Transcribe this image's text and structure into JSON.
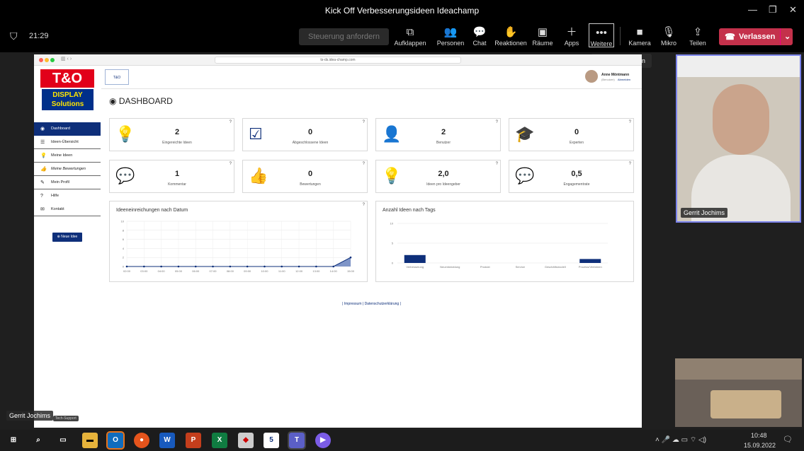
{
  "window": {
    "title": "Kick Off Verbesserungsideen Ideachamp"
  },
  "meeting": {
    "time": "21:29",
    "control_request": "Steuerung anfordern",
    "buttons": {
      "popout": "Aufklappen",
      "people": "Personen",
      "chat": "Chat",
      "reactions": "Reaktionen",
      "rooms": "Räume",
      "apps": "Apps",
      "more": "Weitere",
      "camera": "Kamera",
      "mic": "Mikro",
      "share": "Teilen",
      "leave": "Verlassen"
    },
    "tooltip": "Weitere Aktionen"
  },
  "browser": {
    "url": "ts-ds.idea-champ.com"
  },
  "app": {
    "logo_top": "T&O",
    "logo_bottom_1": "DISPLAY",
    "logo_bottom_2": "Solutions",
    "user": {
      "name": "Anne Möntmann",
      "role": "(Benutzer)",
      "logout": "Abmelden"
    },
    "nav": [
      {
        "label": "Dashboard",
        "icon": "dashboard-icon"
      },
      {
        "label": "Ideen-Übersicht",
        "icon": "list-icon"
      },
      {
        "label": "Meine Ideen",
        "icon": "bulb-icon"
      },
      {
        "label": "Meine Bewertungen",
        "icon": "thumb-icon"
      },
      {
        "label": "Mein Profil",
        "icon": "edit-icon"
      },
      {
        "label": "Hilfe",
        "icon": "help-icon"
      },
      {
        "label": "Kontakt",
        "icon": "mail-icon"
      }
    ],
    "new_idea_button": "⊕ Neue Idee",
    "page_title": "DASHBOARD",
    "cards": [
      {
        "value": "2",
        "label": "Eingereichte Ideen",
        "icon": "bulb-icon"
      },
      {
        "value": "0",
        "label": "Abgeschlossene Ideen",
        "icon": "check-icon"
      },
      {
        "value": "2",
        "label": "Benutzer",
        "icon": "user-icon"
      },
      {
        "value": "0",
        "label": "Experten",
        "icon": "graduation-cap-icon"
      },
      {
        "value": "1",
        "label": "Kommentar",
        "icon": "comments-icon"
      },
      {
        "value": "0",
        "label": "Bewertungen",
        "icon": "thumbs-up-icon"
      },
      {
        "value": "2,0",
        "label": "Ideen pro Ideengeber",
        "icon": "bulb-icon"
      },
      {
        "value": "0,5",
        "label": "Engagementrate",
        "icon": "comments-icon"
      }
    ],
    "footer": "| Impressum | Datenschutzerklärung |"
  },
  "chart_data": [
    {
      "type": "area",
      "title": "Ideeneinreichungen nach Datum",
      "x": [
        "02:00",
        "03:00",
        "04:00",
        "05:00",
        "06:00",
        "07:00",
        "08:00",
        "09:00",
        "10:00",
        "11:00",
        "12:00",
        "13:00",
        "14:00",
        "15:00"
      ],
      "values": [
        0,
        0,
        0,
        0,
        0,
        0,
        0,
        0,
        0,
        0,
        0,
        0,
        0,
        2
      ],
      "ylim": [
        0,
        10
      ],
      "yticks": [
        0,
        2,
        4,
        6,
        8,
        10
      ],
      "grid": true,
      "color": "#0e2f7a"
    },
    {
      "type": "bar",
      "title": "Anzahl Ideen nach Tags",
      "categories": [
        "Verbesserung",
        "Neuentwicklung",
        "Produkt",
        "Service",
        "Geschäftsmodell",
        "Prozess/Verfahren"
      ],
      "values": [
        2,
        0,
        0,
        0,
        0,
        1
      ],
      "ylim": [
        0,
        10
      ],
      "yticks": [
        0,
        5,
        10
      ],
      "grid": true,
      "color": "#0e2f7a"
    }
  ],
  "participants": {
    "self": "Gerrit Jochims",
    "presenter": "Gerrit Jochims",
    "badge": "Tech-Support"
  },
  "taskbar": {
    "time": "10:48",
    "date": "15.09.2022"
  }
}
